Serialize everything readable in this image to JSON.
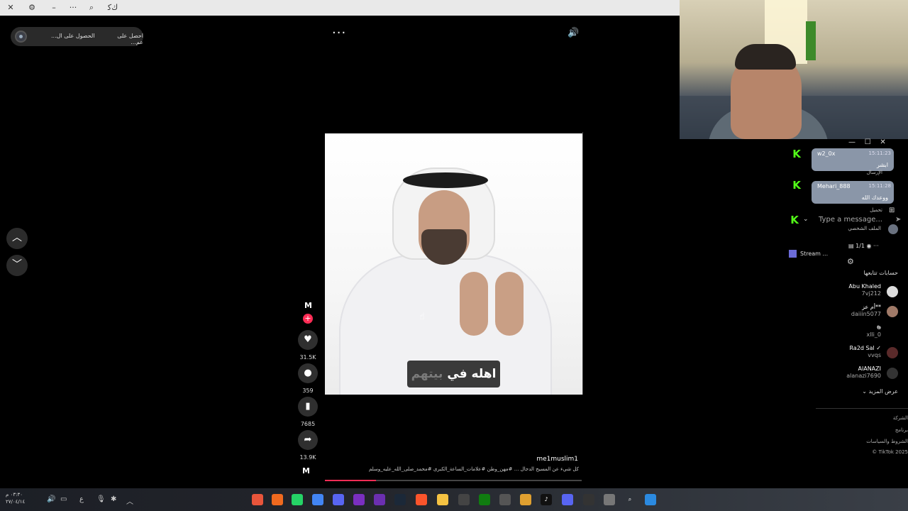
{
  "top_bar": {
    "close": "✕",
    "settings": "⚙",
    "minimize": "–",
    "more": "···",
    "search": "⌕",
    "app": "ﻙﻛ"
  },
  "get_app": {
    "text_1": "الحصول على ال...",
    "text_2": "احصل على عم..."
  },
  "player": {
    "more": "···",
    "volume": "🔊",
    "caption_main": "اهله في",
    "caption_dim": "بيتهم"
  },
  "actions": {
    "likes": "31.5K",
    "comments": "359",
    "saves": "7685",
    "shares": "13.9K"
  },
  "post": {
    "author": "me1muslim1",
    "description": "كل شيء عن المسيح الدجال ...  #مهن_وطن  #علامات_الساعة_الكبرى  #محمد_صلى_الله_عليه_وسلم",
    "progress": 0.2
  },
  "chat": {
    "messages": [
      {
        "user": "w2_0x",
        "time": "15:11:23",
        "text": "ابشر"
      },
      {
        "user": "Mehari_888",
        "time": "15:11:28",
        "text": "ووعدك الله"
      }
    ],
    "input_placeholder": "Type a message...",
    "stream_label": "Stream ...",
    "viewer_count": "1/1",
    "label_send": "الإرسال",
    "label_upload": "تحميل",
    "label_profile": "الملف الشخصي"
  },
  "following": {
    "title": "حسابات تتابعها",
    "accounts": [
      {
        "name": "Abu Khaled",
        "handle": "7vj212"
      },
      {
        "name": "أم عز**",
        "handle": "daiiin5077"
      },
      {
        "name": "𝕲",
        "handle": "xlli_0"
      },
      {
        "name": "Ra2d Sal ✓",
        "handle": "vvqs"
      },
      {
        "name": "AlANAZI",
        "handle": "alanazi7690"
      }
    ],
    "see_more": "عرض المزيد"
  },
  "footer": {
    "company": "الشركة",
    "program": "برنامج",
    "terms": "الشروط والسياسات",
    "copyright": "TikTok 2025 ©"
  },
  "taskbar": {
    "time": "٠٣:٣٠ م",
    "date": "٢٧/٠٤/١٤",
    "lang": "ع"
  },
  "colors": {
    "accent": "#fe2c55",
    "kick_green": "#53fc18",
    "chat_bubble": "#8a96a8"
  }
}
